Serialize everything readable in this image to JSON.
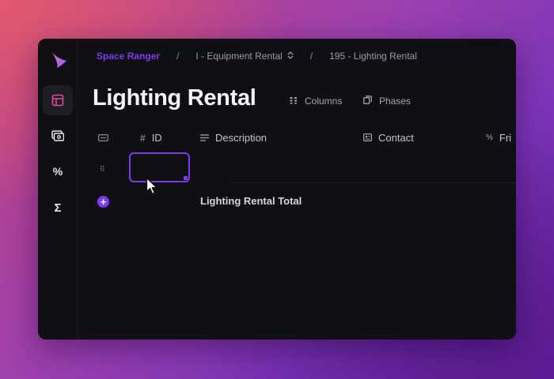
{
  "breadcrumb": {
    "app": "Space Ranger",
    "separator": "/",
    "section": "I - Equipment Rental",
    "section_chevron": "⌃⌄",
    "page": "195 - Lighting Rental"
  },
  "page_title": "Lighting Rental",
  "toolbar": {
    "columns_label": "Columns",
    "phases_label": "Phases"
  },
  "sidebar": {
    "items": [
      {
        "icon": "table-icon",
        "active": true
      },
      {
        "icon": "currency-icon",
        "active": false
      },
      {
        "icon": "percent-icon",
        "glyph": "%",
        "active": false
      },
      {
        "icon": "sigma-icon",
        "glyph": "Σ",
        "active": false
      }
    ]
  },
  "table": {
    "columns": [
      {
        "icon": "hash-icon",
        "icon_glyph": "#",
        "label": "ID"
      },
      {
        "icon": "text-lines-icon",
        "icon_glyph": "≡",
        "label": "Description"
      },
      {
        "icon": "contact-card-icon",
        "label": "Contact"
      },
      {
        "icon": "percent-icon",
        "icon_glyph": "%",
        "label": "Fri"
      }
    ],
    "row": {
      "drag_glyph": "⠿",
      "id_value": ""
    },
    "add_glyph": "+",
    "total_label": "Lighting Rental Total"
  },
  "colors": {
    "accent": "#7c3aed",
    "window_bg": "#101014"
  }
}
